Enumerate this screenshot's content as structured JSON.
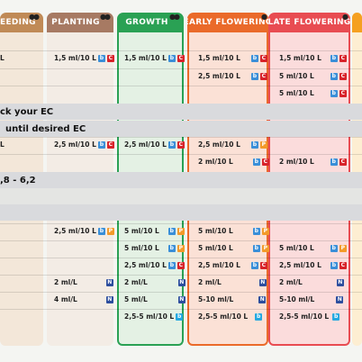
{
  "headers": {
    "feeding": "EEDING",
    "planting": "PLANTING",
    "growth": "GROWTH",
    "early": "EARLY FLOWERING",
    "late": "LATE FLOWERING"
  },
  "bands": {
    "check_ec": "ck your EC",
    "until_ec": "until desired EC",
    "ph": ",8 - 6,2"
  },
  "colors": {
    "feeding": "#c08a56",
    "planting": "#a77a63",
    "growth": "#2aa154",
    "early": "#ea6a2a",
    "late": "#e84c52",
    "next": "#f5a020"
  },
  "rows": {
    "r1": {
      "feed": "L",
      "plant": "1,5 ml/10 L",
      "growth": "1,5 ml/10 L",
      "early": "1,5 ml/10 L",
      "late": "1,5 ml/10 L"
    },
    "r2": {
      "early": "2,5 ml/10 L",
      "late": "5 ml/10 L"
    },
    "r3": {
      "late": "5 ml/10 L"
    },
    "r4": {
      "feed": "L",
      "plant": "2,5 ml/10 L",
      "growth": "2,5 ml/10 L",
      "early": "2,5 ml/10 L"
    },
    "r5": {
      "early": "2 ml/10 L",
      "late": "2 ml/10 L"
    },
    "r6": {
      "plant": "2,5 ml/10 L",
      "growth": "5 ml/10 L",
      "early": "5 ml/10 L"
    },
    "r7": {
      "growth": "5 ml/10 L",
      "early": "5 ml/10 L",
      "late": "5 ml/10 L"
    },
    "r8": {
      "growth": "2,5 ml/10 L",
      "early": "2,5 ml/10 L",
      "late": "2,5 ml/10 L"
    },
    "r9": {
      "plant": "2 ml/L",
      "growth": "2 ml/L",
      "early": "2 ml/L",
      "late": "2 ml/L"
    },
    "r10": {
      "plant": "4 ml/L",
      "growth": "5 ml/L",
      "early": "5-10 ml/L",
      "late": "5-10 ml/L"
    },
    "r11": {
      "growth": "2,5-5 ml/10 L",
      "early": "2,5-5 ml/10 L",
      "late": "2,5-5 ml/10 L"
    }
  }
}
